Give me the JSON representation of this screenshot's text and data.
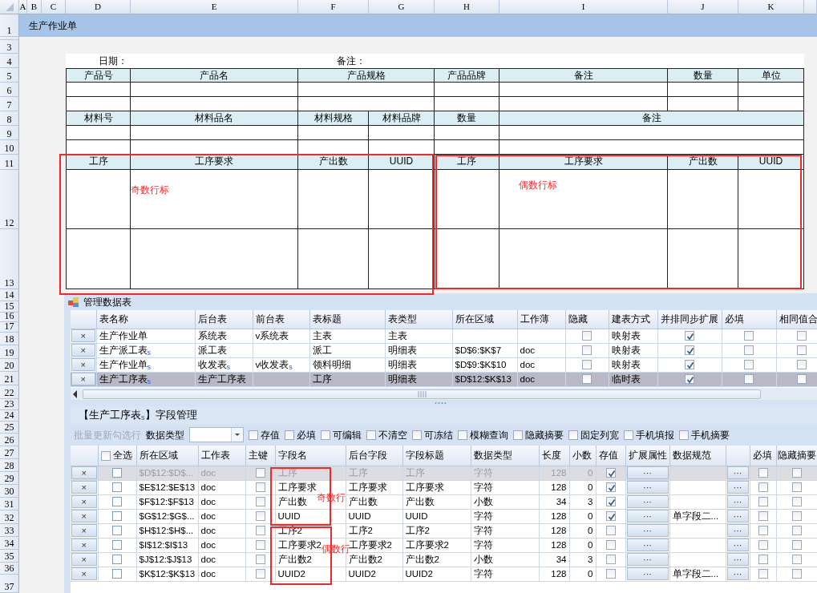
{
  "sheet": {
    "columns": [
      "A",
      "B",
      "C",
      "D",
      "E",
      "F",
      "G",
      "H",
      "I",
      "J",
      "K"
    ],
    "rows": [
      "1",
      "3",
      "4",
      "5",
      "6",
      "7",
      "8",
      "9",
      "10",
      "11",
      "12",
      "13",
      "14",
      "15",
      "16",
      "17",
      "18",
      "19",
      "20",
      "21",
      "22",
      "23",
      "24",
      "25",
      "26",
      "27",
      "28",
      "29",
      "30",
      "31",
      "32",
      "33",
      "34",
      "35",
      "36",
      "37"
    ],
    "title": "生产作业单"
  },
  "form": {
    "header_fields": [
      "日期：",
      "备注："
    ],
    "sections": [
      {
        "headers": [
          "产品号",
          "产品名",
          "产品规格",
          "产品品牌",
          "备注",
          "数量",
          "单位"
        ]
      },
      {
        "headers": [
          "材料号",
          "材料品名",
          "材料规格",
          "材料品牌",
          "数量",
          "备注"
        ]
      },
      {
        "headers": [
          "工序",
          "工序要求",
          "产出数",
          "UUID",
          "工序",
          "工序要求",
          "产出数",
          "UUID"
        ]
      }
    ],
    "notes": [
      "奇数行标",
      "偶数行标"
    ]
  },
  "table_panel": {
    "title": "管理数据表",
    "columns": [
      "表名称",
      "后台表",
      "前台表",
      "表标题",
      "表类型",
      "所在区域",
      "工作薄",
      "隐藏",
      "建表方式",
      "并排同步扩展",
      "必填",
      "相同值合"
    ],
    "rows": [
      {
        "delete": "×",
        "name": "生产作业单",
        "backend": "系统表",
        "frontend": "v系统表",
        "title": "主表",
        "type": "主表",
        "hidden": false,
        "build": "映射表",
        "sync_expand": true,
        "required": false,
        "merge": false,
        "selected": false
      },
      {
        "delete": "×",
        "name": "生产派工表$_{s}$",
        "backend": "派工表",
        "title": "派工",
        "type": "明细表",
        "range": "$D$6:$K$7",
        "book": "doc",
        "hidden": false,
        "build": "映射表",
        "sync_expand": true,
        "required": false,
        "merge": false,
        "selected": false
      },
      {
        "delete": "×",
        "name": "生产作业单$_{s}$",
        "backend": "收发表$_{s}$",
        "frontend": "v收发表$_{s}$",
        "title": "领料明细",
        "type": "明细表",
        "range": "$D$9:$K$10",
        "book": "doc",
        "hidden": false,
        "build": "映射表",
        "sync_expand": true,
        "required": false,
        "merge": false,
        "selected": false
      },
      {
        "delete": "×",
        "name": "生产工序表$_{s}$",
        "backend": "生产工序表",
        "title": "工序",
        "type": "明细表",
        "range": "$D$12:$K$13",
        "book": "doc",
        "hidden": false,
        "build": "临时表",
        "sync_expand": true,
        "required": false,
        "merge": false,
        "selected": true
      }
    ]
  },
  "field_panel": {
    "title": "【生产工序表$_{s}$】字段管理",
    "batch_update": {
      "label": "批量更新勾选行",
      "disabled": true
    },
    "data_type_label": "数据类型",
    "options": [
      {
        "label": "存值",
        "checked": false
      },
      {
        "label": "必填",
        "checked": false
      },
      {
        "label": "可编辑",
        "checked": false
      },
      {
        "label": "不清空",
        "checked": false
      },
      {
        "label": "可冻结",
        "checked": false
      },
      {
        "label": "模糊查询",
        "checked": false
      },
      {
        "label": "隐藏摘要",
        "checked": false
      },
      {
        "label": "固定列宽",
        "checked": false
      },
      {
        "label": "手机填报",
        "checked": false
      },
      {
        "label": "手机摘要",
        "checked": false
      }
    ],
    "select_all": {
      "label": "全选",
      "checked": false
    },
    "columns": [
      "所在区域",
      "工作表",
      "主键",
      "字段名",
      "后台字段",
      "字段标题",
      "数据类型",
      "长度",
      "小数",
      "存值",
      "扩展属性",
      "数据规范",
      "必填",
      "隐藏摘要"
    ],
    "rows": [
      {
        "delete": "×",
        "selected": false,
        "range": "$D$12:$D$...",
        "sheet": "doc",
        "primary_key": false,
        "field": "工序",
        "backend_field": "工序",
        "field_title": "工序",
        "data_type": "字符",
        "length": "128",
        "decimals": "0",
        "store": true,
        "ext": "···",
        "spec_button": "···",
        "required": false,
        "hide_summary": false,
        "disabled": true
      },
      {
        "delete": "×",
        "selected": false,
        "range": "$E$12:$E$13",
        "sheet": "doc",
        "primary_key": false,
        "field": "工序要求",
        "backend_field": "工序要求",
        "field_title": "工序要求",
        "data_type": "字符",
        "length": "128",
        "decimals": "0",
        "store": true,
        "ext": "···",
        "spec_button": "···",
        "required": false,
        "hide_summary": false,
        "disabled": false
      },
      {
        "delete": "×",
        "selected": false,
        "range": "$F$12:$F$13",
        "sheet": "doc",
        "primary_key": false,
        "field": "产出数",
        "backend_field": "产出数",
        "field_title": "产出数",
        "data_type": "小数",
        "length": "34",
        "decimals": "3",
        "store": true,
        "ext": "···",
        "spec_button": "···",
        "required": false,
        "hide_summary": false,
        "disabled": false
      },
      {
        "delete": "×",
        "selected": false,
        "range": "$G$12:$G$...",
        "sheet": "doc",
        "primary_key": false,
        "field": "UUID",
        "backend_field": "UUID",
        "field_title": "UUID",
        "data_type": "字符",
        "length": "128",
        "decimals": "0",
        "store": true,
        "ext": "···",
        "spec": "单字段二...",
        "spec_button": "···",
        "required": false,
        "hide_summary": false,
        "disabled": false
      },
      {
        "delete": "×",
        "selected": false,
        "range": "$H$12:$H$...",
        "sheet": "doc",
        "primary_key": false,
        "field": "工序2",
        "backend_field": "工序2",
        "field_title": "工序2",
        "data_type": "字符",
        "length": "128",
        "decimals": "0",
        "store": false,
        "ext": "···",
        "spec_button": "···",
        "required": false,
        "hide_summary": false,
        "disabled": false
      },
      {
        "delete": "×",
        "selected": false,
        "range": "$I$12:$I$13",
        "sheet": "doc",
        "primary_key": false,
        "field": "工序要求2",
        "backend_field": "工序要求2",
        "field_title": "工序要求2",
        "data_type": "字符",
        "length": "128",
        "decimals": "0",
        "store": false,
        "ext": "···",
        "spec_button": "···",
        "required": false,
        "hide_summary": false,
        "disabled": false
      },
      {
        "delete": "×",
        "selected": false,
        "range": "$J$12:$J$13",
        "sheet": "doc",
        "primary_key": false,
        "field": "产出数2",
        "backend_field": "产出数2",
        "field_title": "产出数2",
        "data_type": "小数",
        "length": "34",
        "decimals": "3",
        "store": false,
        "ext": "···",
        "spec_button": "···",
        "required": false,
        "hide_summary": false,
        "disabled": false
      },
      {
        "delete": "×",
        "selected": false,
        "range": "$K$12:$K$13",
        "sheet": "doc",
        "primary_key": false,
        "field": "UUID2",
        "backend_field": "UUID2",
        "field_title": "UUID2",
        "data_type": "字符",
        "length": "128",
        "decimals": "0",
        "store": false,
        "ext": "···",
        "spec": "单字段二...",
        "spec_button": "···",
        "required": false,
        "hide_summary": false,
        "disabled": false
      }
    ],
    "notes": [
      "奇数行",
      "偶数行"
    ]
  }
}
